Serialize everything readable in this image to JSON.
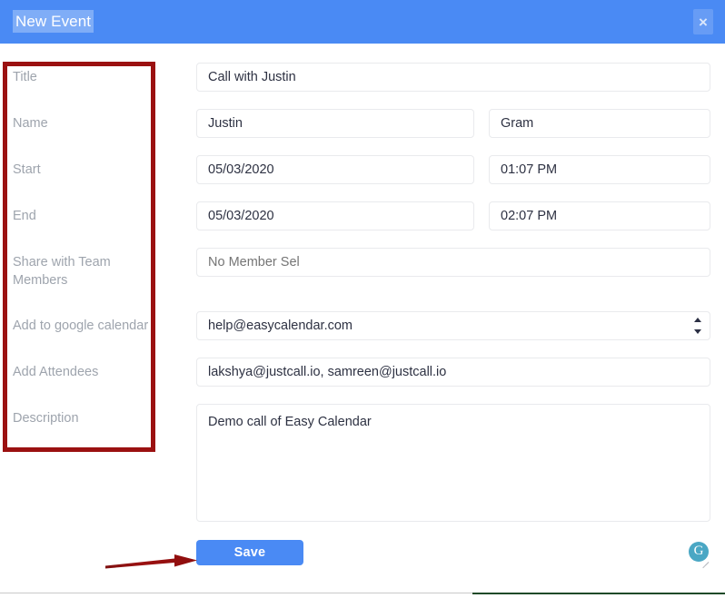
{
  "header": {
    "title": "New Event",
    "close_label": "×",
    "close_icon": "close-icon",
    "bg_color": "#4a8af4",
    "title_highlight_color": "#7fadf7"
  },
  "form": {
    "labels": {
      "title": "Title",
      "name": "Name",
      "start": "Start",
      "end": "End",
      "share": "Share with Team Members",
      "google_calendar": "Add to google calendar",
      "attendees": "Add Attendees",
      "description": "Description"
    },
    "fields": {
      "title_value": "Call with Justin",
      "first_name_value": "Justin",
      "last_name_value": "Gram",
      "start_date_value": "05/03/2020",
      "start_time_value": "01:07 PM",
      "end_date_value": "05/03/2020",
      "end_time_value": "02:07 PM",
      "share_placeholder": "No Member Sel",
      "share_value": "",
      "google_calendar_selected": "help@easycalendar.com",
      "google_calendar_options": [
        "help@easycalendar.com"
      ],
      "attendees_value": "lakshya@justcall.io, samreen@justcall.io",
      "description_value": "Demo call of Easy Calendar"
    }
  },
  "actions": {
    "save_label": "Save",
    "save_color": "#4a8af4"
  },
  "widgets": {
    "grammarly_letter": "G",
    "grammarly_color": "#4aa7c4"
  },
  "annotations": {
    "highlight_color": "#9b1111",
    "box_target": "form-labels-column",
    "arrow_target": "save-button"
  }
}
